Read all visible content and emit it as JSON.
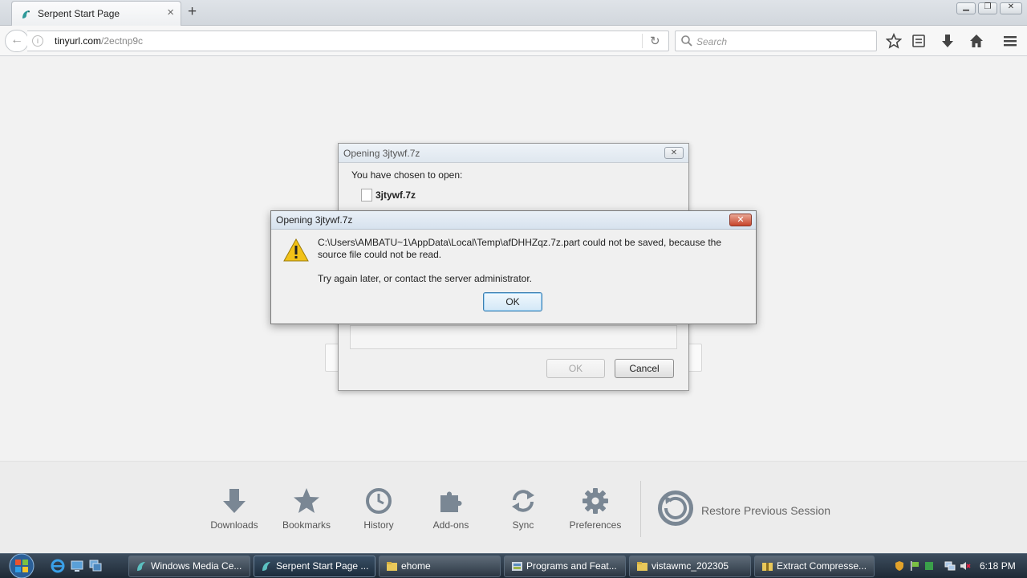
{
  "browser": {
    "tab_title": "Serpent Start Page",
    "new_tab_label": "+",
    "url_host": "tinyurl.com",
    "url_path": "/2ectnp9c",
    "search_placeholder": "Search"
  },
  "launcher": {
    "items": [
      {
        "label": "Downloads",
        "icon": "download-arrow-icon"
      },
      {
        "label": "Bookmarks",
        "icon": "star-icon"
      },
      {
        "label": "History",
        "icon": "clock-icon"
      },
      {
        "label": "Add-ons",
        "icon": "puzzle-icon"
      },
      {
        "label": "Sync",
        "icon": "sync-icon"
      },
      {
        "label": "Preferences",
        "icon": "gear-icon"
      }
    ],
    "restore_label": "Restore Previous Session"
  },
  "back_dialog": {
    "title": "Opening 3jtywf.7z",
    "prompt": "You have chosen to open:",
    "filename": "3jtywf.7z",
    "ok_label": "OK",
    "cancel_label": "Cancel"
  },
  "error_dialog": {
    "title": "Opening 3jtywf.7z",
    "line1": "C:\\Users\\AMBATU~1\\AppData\\Local\\Temp\\afDHHZqz.7z.part could not be saved, because the",
    "line2": "source file could not be read.",
    "line3": "Try again later, or contact the server administrator.",
    "ok_label": "OK",
    "close_label": "✕"
  },
  "taskbar": {
    "tasks": [
      {
        "label": "Windows Media Ce..."
      },
      {
        "label": "Serpent Start Page ..."
      },
      {
        "label": "ehome"
      },
      {
        "label": "Programs and Feat..."
      },
      {
        "label": "vistawmc_202305"
      },
      {
        "label": "Extract Compresse..."
      }
    ],
    "clock": "6:18 PM"
  },
  "colors": {
    "accent_blue": "#3c7fb1",
    "close_red": "#c7442b",
    "warning_yellow": "#f2c218"
  }
}
